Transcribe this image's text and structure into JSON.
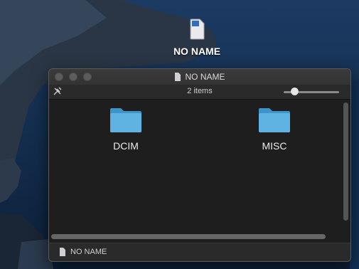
{
  "desktop": {
    "volume_label": "NO NAME"
  },
  "window": {
    "title": "NO NAME",
    "status_text": "2 items",
    "icon_size_fraction": 0.15,
    "folders": [
      {
        "name": "DCIM",
        "icon": "folder-icon"
      },
      {
        "name": "MISC",
        "icon": "folder-icon"
      }
    ],
    "path_bar_label": "NO NAME"
  },
  "colors": {
    "folder_blue": "#5eb3e2",
    "folder_blue_dark": "#3e93c8",
    "window_bg": "#1f1f1f"
  }
}
